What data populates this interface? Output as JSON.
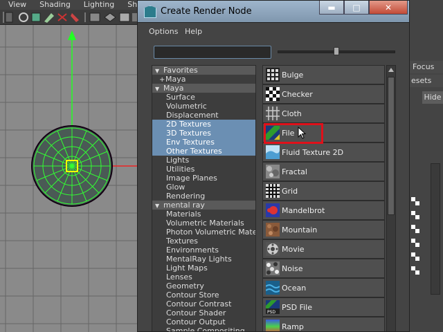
{
  "viewport": {
    "menu": [
      "View",
      "Shading",
      "Lighting",
      "Show"
    ]
  },
  "right_panel": {
    "focus_label": "Focus",
    "presets_label": "esets",
    "hide_label": "Hide"
  },
  "dialog": {
    "title": "Create Render Node",
    "menu": [
      "Options",
      "Help"
    ],
    "search_placeholder": "",
    "tree": [
      {
        "label": "Favorites",
        "kind": "header"
      },
      {
        "label": "Maya",
        "kind": "plus"
      },
      {
        "label": "Maya",
        "kind": "header"
      },
      {
        "label": "Surface",
        "kind": "item"
      },
      {
        "label": "Volumetric",
        "kind": "item"
      },
      {
        "label": "Displacement",
        "kind": "item"
      },
      {
        "label": "2D Textures",
        "kind": "item",
        "selected": true
      },
      {
        "label": "3D Textures",
        "kind": "item",
        "selected": true
      },
      {
        "label": "Env Textures",
        "kind": "item",
        "selected": true
      },
      {
        "label": "Other Textures",
        "kind": "item",
        "selected": true
      },
      {
        "label": "Lights",
        "kind": "item"
      },
      {
        "label": "Utilities",
        "kind": "item"
      },
      {
        "label": "Image Planes",
        "kind": "item"
      },
      {
        "label": "Glow",
        "kind": "item"
      },
      {
        "label": "Rendering",
        "kind": "item"
      },
      {
        "label": "mental ray",
        "kind": "header"
      },
      {
        "label": "Materials",
        "kind": "item"
      },
      {
        "label": "Volumetric Materials",
        "kind": "item"
      },
      {
        "label": "Photon Volumetric Materi...",
        "kind": "item"
      },
      {
        "label": "Textures",
        "kind": "item"
      },
      {
        "label": "Environments",
        "kind": "item"
      },
      {
        "label": "MentalRay Lights",
        "kind": "item"
      },
      {
        "label": "Light Maps",
        "kind": "item"
      },
      {
        "label": "Lenses",
        "kind": "item"
      },
      {
        "label": "Geometry",
        "kind": "item"
      },
      {
        "label": "Contour Store",
        "kind": "item"
      },
      {
        "label": "Contour Contrast",
        "kind": "item"
      },
      {
        "label": "Contour Shader",
        "kind": "item"
      },
      {
        "label": "Contour Output",
        "kind": "item"
      },
      {
        "label": "Sample Compositing",
        "kind": "item"
      }
    ],
    "nodes": [
      {
        "label": "Bulge",
        "icon": "bulge-icon",
        "color": "#222"
      },
      {
        "label": "Checker",
        "icon": "checker-icon",
        "color": "#fff"
      },
      {
        "label": "Cloth",
        "icon": "cloth-icon",
        "color": "#777"
      },
      {
        "label": "File",
        "icon": "file-icon",
        "color": "#2a7a2a"
      },
      {
        "label": "Fluid Texture 2D",
        "icon": "fluid-texture-icon",
        "color": "#8fc6e8"
      },
      {
        "label": "Fractal",
        "icon": "fractal-icon",
        "color": "#999"
      },
      {
        "label": "Grid",
        "icon": "grid-icon",
        "color": "#222"
      },
      {
        "label": "Mandelbrot",
        "icon": "mandelbrot-icon",
        "color": "#c44"
      },
      {
        "label": "Mountain",
        "icon": "mountain-icon",
        "color": "#8a5a3a"
      },
      {
        "label": "Movie",
        "icon": "movie-icon",
        "color": "#bbb"
      },
      {
        "label": "Noise",
        "icon": "noise-icon",
        "color": "#aaa"
      },
      {
        "label": "Ocean",
        "icon": "ocean-icon",
        "color": "#2b7fb0"
      },
      {
        "label": "PSD File",
        "icon": "psd-file-icon",
        "color": "#2a7a2a"
      },
      {
        "label": "Ramp",
        "icon": "ramp-icon",
        "color": "#6c4"
      }
    ]
  }
}
